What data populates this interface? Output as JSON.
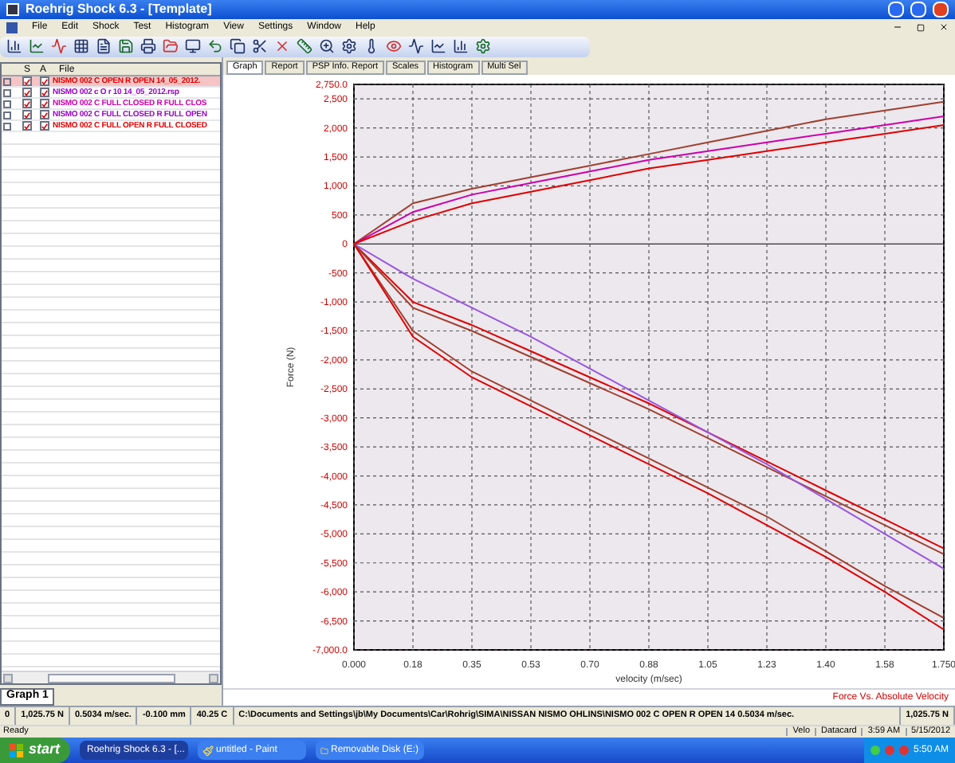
{
  "window": {
    "title": "Roehrig Shock 6.3 - [Template]"
  },
  "menu": [
    "File",
    "Edit",
    "Shock",
    "Test",
    "Histogram",
    "View",
    "Settings",
    "Window",
    "Help"
  ],
  "file_list": {
    "columns": [
      "S",
      "A",
      "File"
    ],
    "rows": [
      {
        "s_checked": true,
        "a_checked": true,
        "name": "NISMO 002 C OPEN R OPEN 14_05_2012.",
        "color": "#e00000",
        "selected": true
      },
      {
        "s_checked": true,
        "a_checked": true,
        "name": "NISMO 002 c O r 10 14_05_2012.rsp",
        "color": "#9900cc",
        "selected": false
      },
      {
        "s_checked": true,
        "a_checked": true,
        "name": "NISMO 002 C FULL CLOSED R FULL CLOS",
        "color": "#cc00aa",
        "selected": false
      },
      {
        "s_checked": true,
        "a_checked": true,
        "name": "NISMO 002 C FULL CLOSED R FULL OPEN",
        "color": "#9900cc",
        "selected": false
      },
      {
        "s_checked": true,
        "a_checked": true,
        "name": "NISMO 002 C FULL OPEN R FULL CLOSED",
        "color": "#e00000",
        "selected": false
      }
    ]
  },
  "graph_tab": {
    "label": "Graph 1",
    "selected": true
  },
  "tabs": [
    {
      "label": "Graph",
      "selected": true
    },
    {
      "label": "Report",
      "selected": false
    },
    {
      "label": "PSP Info. Report",
      "selected": false
    },
    {
      "label": "Scales",
      "selected": false
    },
    {
      "label": "Histogram",
      "selected": false
    },
    {
      "label": "Multi Sel",
      "selected": false
    }
  ],
  "chart": {
    "chart_data": {
      "type": "line",
      "grid": true,
      "xlabel": "velocity (m/sec)",
      "ylabel": "Force (N)",
      "x": [
        0,
        0.175,
        0.35,
        0.525,
        0.7,
        0.875,
        1.05,
        1.225,
        1.4,
        1.575,
        1.75
      ],
      "xlim": [
        0,
        1.75
      ],
      "ylim": [
        -7000,
        2750
      ],
      "xticks": [
        {
          "value": 0,
          "label": "0.000"
        },
        {
          "value": 0.175,
          "label": "0.18"
        },
        {
          "value": 0.35,
          "label": "0.35"
        },
        {
          "value": 0.525,
          "label": "0.53"
        },
        {
          "value": 0.7,
          "label": "0.70"
        },
        {
          "value": 0.875,
          "label": "0.88"
        },
        {
          "value": 1.05,
          "label": "1.05"
        },
        {
          "value": 1.225,
          "label": "1.23"
        },
        {
          "value": 1.4,
          "label": "1.40"
        },
        {
          "value": 1.575,
          "label": "1.58"
        },
        {
          "value": 1.75,
          "label": "1.750"
        }
      ],
      "yticks": [
        {
          "value": 2750,
          "label": "2,750.0"
        },
        {
          "value": 2500,
          "label": "2,500"
        },
        {
          "value": 2000,
          "label": "2,000"
        },
        {
          "value": 1500,
          "label": "1,500"
        },
        {
          "value": 1000,
          "label": "1,000"
        },
        {
          "value": 500,
          "label": "500"
        },
        {
          "value": 0,
          "label": "0"
        },
        {
          "value": -500,
          "label": "-500"
        },
        {
          "value": -1000,
          "label": "-1,000"
        },
        {
          "value": -1500,
          "label": "-1,500"
        },
        {
          "value": -2000,
          "label": "-2,000"
        },
        {
          "value": -2500,
          "label": "-2,500"
        },
        {
          "value": -3000,
          "label": "-3,000"
        },
        {
          "value": -3500,
          "label": "-3,500"
        },
        {
          "value": -4000,
          "label": "-4,000"
        },
        {
          "value": -4500,
          "label": "-4,500"
        },
        {
          "value": -5000,
          "label": "-5,000"
        },
        {
          "value": -5500,
          "label": "-5,500"
        },
        {
          "value": -6000,
          "label": "-6,000"
        },
        {
          "value": -6500,
          "label": "-6,500"
        },
        {
          "value": -7000,
          "label": "-7,000.0"
        }
      ],
      "series": [
        {
          "color": "#a04030",
          "values": [
            0,
            700,
            950,
            1150,
            1350,
            1550,
            1750,
            1950,
            2150,
            2300,
            2450
          ]
        },
        {
          "color": "#cc00aa",
          "values": [
            0,
            550,
            850,
            1050,
            1250,
            1450,
            1600,
            1750,
            1900,
            2050,
            2200
          ]
        },
        {
          "color": "#e00000",
          "values": [
            0,
            400,
            700,
            900,
            1100,
            1300,
            1450,
            1600,
            1750,
            1900,
            2050
          ]
        },
        {
          "color": "#e00000",
          "values": [
            0,
            -1000,
            -1400,
            -1850,
            -2300,
            -2750,
            -3250,
            -3750,
            -4250,
            -4750,
            -5250
          ]
        },
        {
          "color": "#a04030",
          "values": [
            0,
            -1100,
            -1500,
            -1950,
            -2400,
            -2850,
            -3350,
            -3850,
            -4350,
            -4850,
            -5350
          ]
        },
        {
          "color": "#9a55e0",
          "values": [
            0,
            -600,
            -1100,
            -1600,
            -2150,
            -2700,
            -3250,
            -3800,
            -4400,
            -5000,
            -5600
          ]
        },
        {
          "color": "#a04030",
          "values": [
            0,
            -1500,
            -2200,
            -2700,
            -3200,
            -3700,
            -4200,
            -4700,
            -5300,
            -5900,
            -6450
          ]
        },
        {
          "color": "#e00000",
          "values": [
            0,
            -1600,
            -2300,
            -2800,
            -3300,
            -3800,
            -4300,
            -4850,
            -5400,
            -6000,
            -6650
          ]
        }
      ]
    },
    "caption": "Force Vs. Absolute Velocity"
  },
  "status_bar": {
    "cells": [
      "0",
      "1,025.75 N",
      "0.5034 m/sec.",
      "-0.100 mm",
      "40.25 C",
      "C:\\Documents and Settings\\jb\\My Documents\\Car\\Rohrig\\SIMA\\NISSAN NISMO OHLINS\\NISMO 002 C OPEN R OPEN 14 0.5034 m/sec.",
      "1,025.75 N"
    ],
    "message": "Ready",
    "indicators": [
      "Velo",
      "Datacard",
      "3:59 AM",
      "5/15/2012"
    ]
  },
  "taskbar": {
    "start": "start",
    "items": [
      {
        "label": "Roehrig Shock 6.3 - [...",
        "selected": true
      },
      {
        "label": "untitled - Paint",
        "selected": false
      },
      {
        "label": "Removable Disk (E:)",
        "selected": false
      }
    ],
    "clock": "5:50 AM"
  }
}
